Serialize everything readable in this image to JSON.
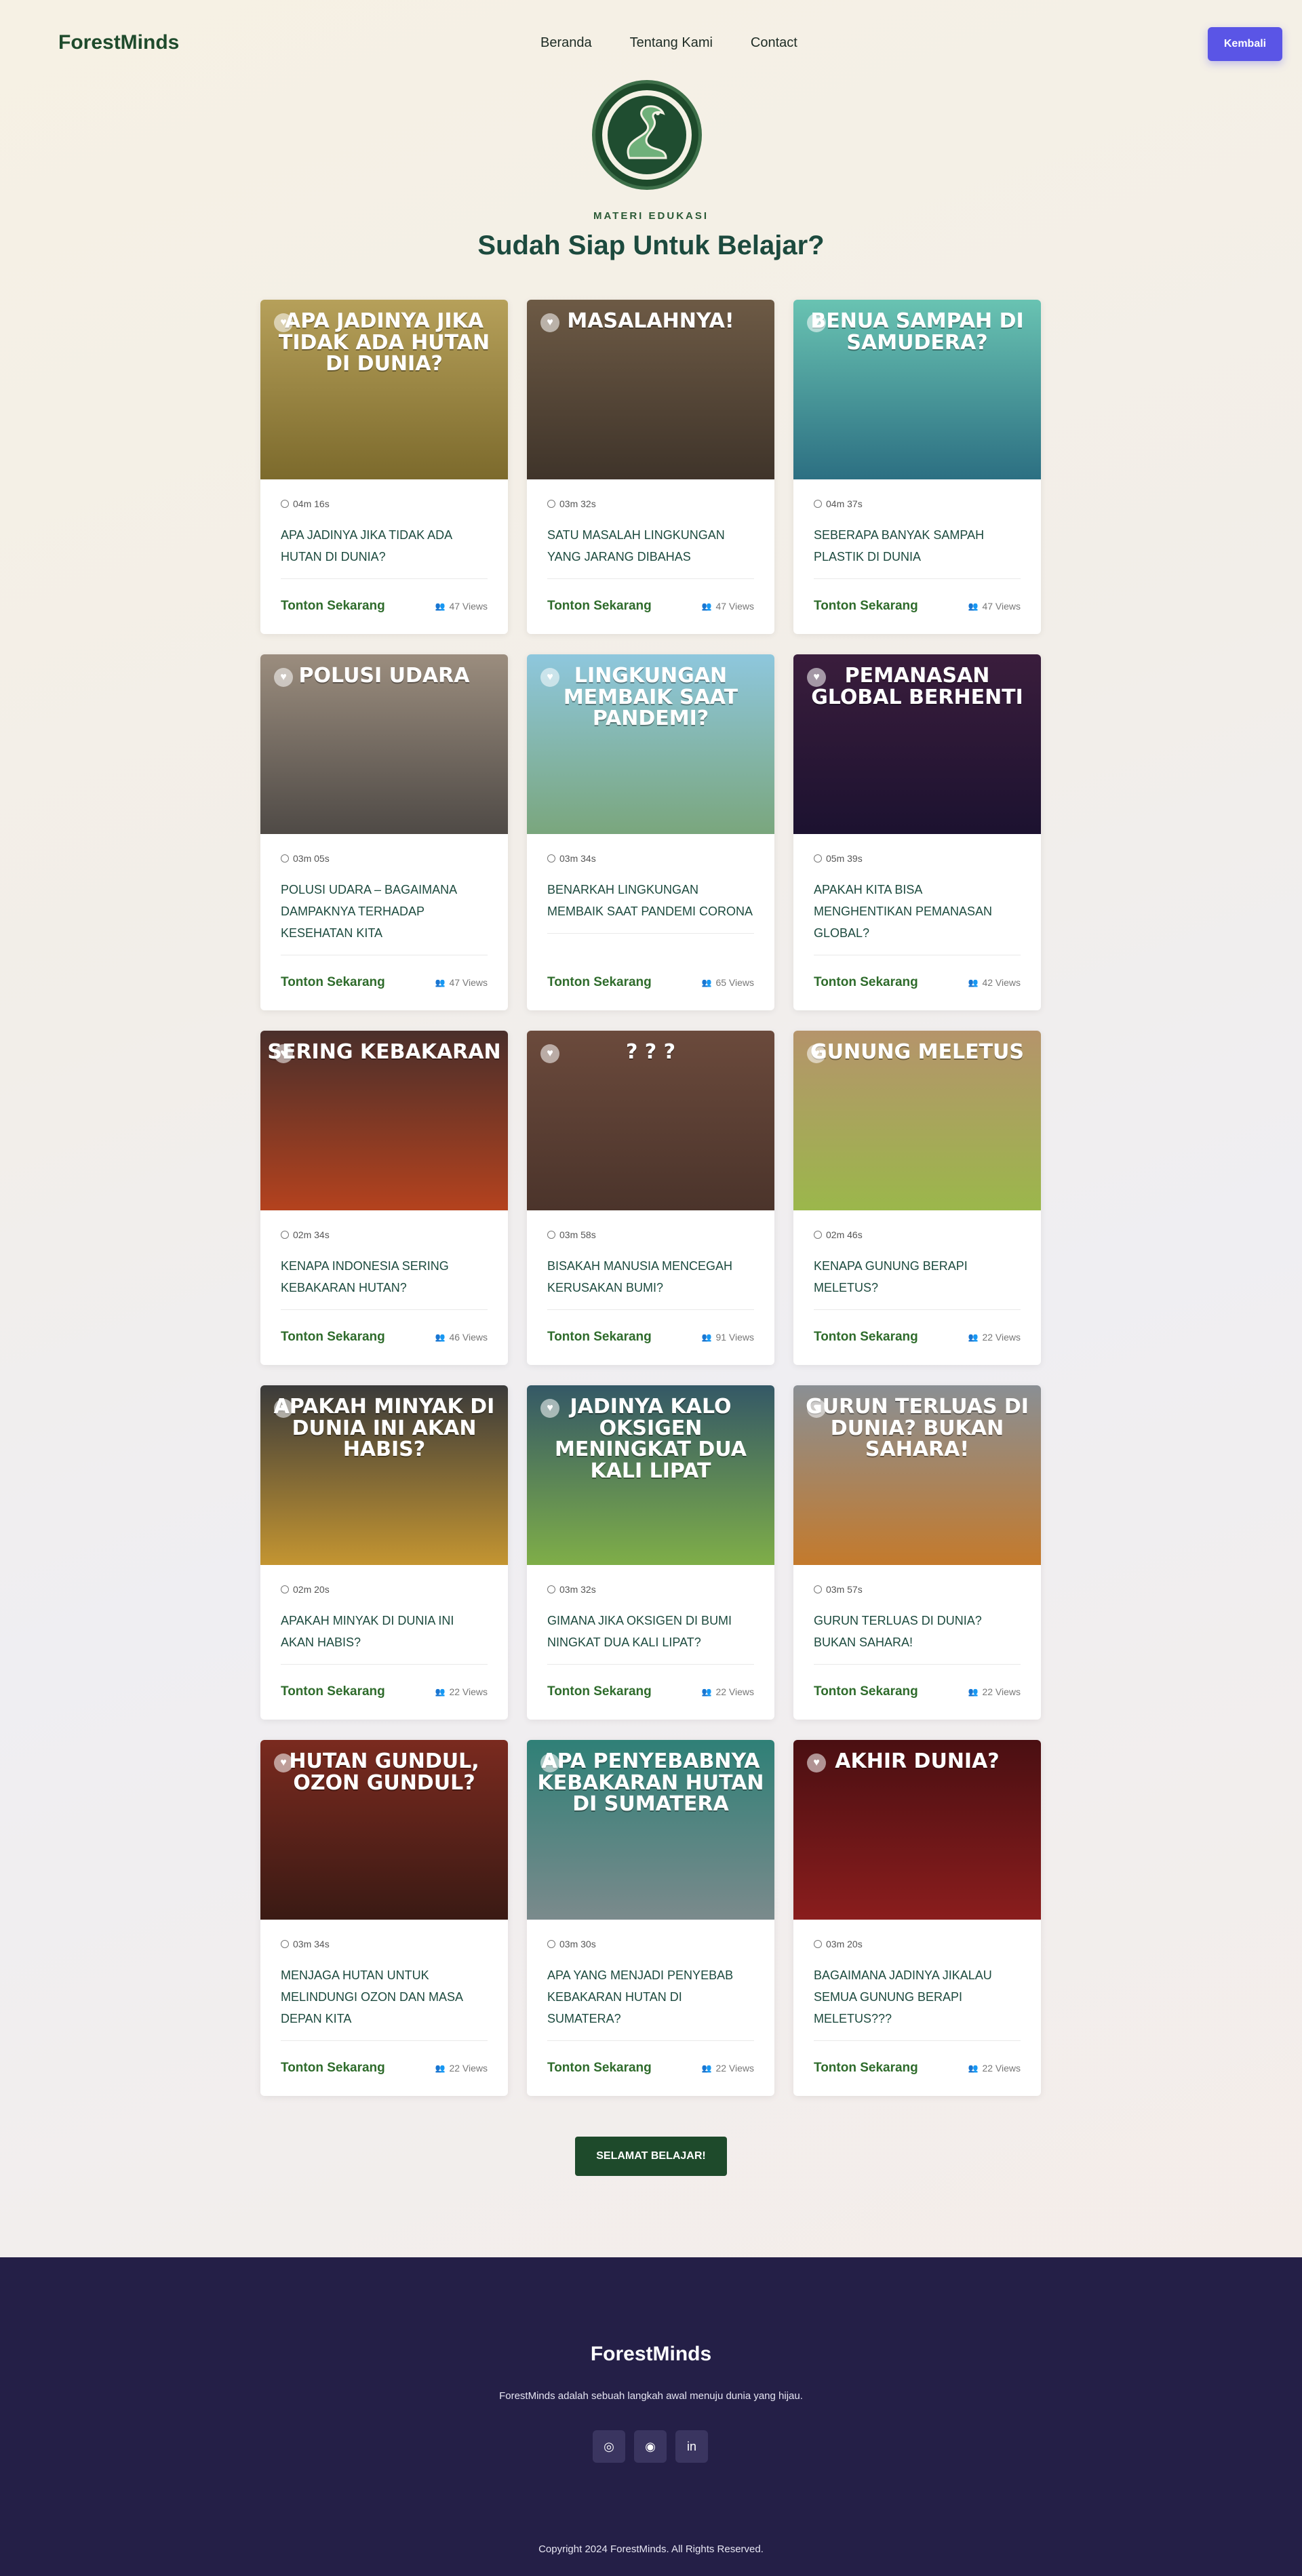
{
  "nav": {
    "brand": "ForestMinds",
    "links": [
      "Beranda",
      "Tentang Kami",
      "Contact"
    ],
    "back_label": "Kembali"
  },
  "hero": {
    "eyebrow": "MATERI EDUKASI",
    "title": "Sudah Siap Untuk Belajar?"
  },
  "cards": [
    {
      "thumb_text": "APA JADINYA JIKA TIDAK ADA HUTAN DI DUNIA?",
      "duration": "04m 16s",
      "title": "APA JADINYA JIKA TIDAK ADA HUTAN DI DUNIA?",
      "cta": "Tonton Sekarang",
      "views": "47 Views",
      "colors": [
        "#b6a05a",
        "#7c6a2c"
      ]
    },
    {
      "thumb_text": "MASALAHNYA!",
      "duration": "03m 32s",
      "title": "SATU MASALAH LINGKUNGAN YANG JARANG DIBAHAS",
      "cta": "Tonton Sekarang",
      "views": "47 Views",
      "colors": [
        "#6d5a45",
        "#3f342a"
      ]
    },
    {
      "thumb_text": "BENUA SAMPAH DI SAMUDERA?",
      "duration": "04m 37s",
      "title": "SEBERAPA BANYAK SAMPAH PLASTIK DI DUNIA",
      "cta": "Tonton Sekarang",
      "views": "47 Views",
      "colors": [
        "#69c3b2",
        "#2c6f82"
      ]
    },
    {
      "thumb_text": "POLUSI UDARA",
      "duration": "03m 05s",
      "title": "POLUSI UDARA – BAGAIMANA DAMPAKNYA TERHADAP KESEHATAN KITA",
      "cta": "Tonton Sekarang",
      "views": "47 Views",
      "colors": [
        "#9b8d7e",
        "#4f4a46"
      ]
    },
    {
      "thumb_text": "LINGKUNGAN MEMBAIK SAAT PANDEMI?",
      "duration": "03m 34s",
      "title": "BENARKAH LINGKUNGAN MEMBAIK SAAT PANDEMI CORONA",
      "cta": "Tonton Sekarang",
      "views": "65 Views",
      "colors": [
        "#8ec7dd",
        "#7aa67d"
      ]
    },
    {
      "thumb_text": "PEMANASAN GLOBAL BERHENTI",
      "duration": "05m 39s",
      "title": "APAKAH KITA BISA MENGHENTIKAN PEMANASAN GLOBAL?",
      "cta": "Tonton Sekarang",
      "views": "42 Views",
      "colors": [
        "#3a1d3c",
        "#1c1230"
      ]
    },
    {
      "thumb_text": "SERING KEBAKARAN",
      "duration": "02m 34s",
      "title": "KENAPA INDONESIA SERING KEBAKARAN HUTAN?",
      "cta": "Tonton Sekarang",
      "views": "46 Views",
      "colors": [
        "#4a2f2b",
        "#b4421e"
      ]
    },
    {
      "thumb_text": "? ? ?",
      "duration": "03m 58s",
      "title": "BISAKAH MANUSIA MENCEGAH KERUSAKAN BUMI?",
      "cta": "Tonton Sekarang",
      "views": "91 Views",
      "colors": [
        "#6b4a3c",
        "#4b342b"
      ]
    },
    {
      "thumb_text": "GUNUNG MELETUS",
      "duration": "02m 46s",
      "title": "KENAPA GUNUNG BERAPI MELETUS?",
      "cta": "Tonton Sekarang",
      "views": "22 Views",
      "colors": [
        "#b5946b",
        "#9bb74b"
      ]
    },
    {
      "thumb_text": "APAKAH MINYAK DI DUNIA INI AKAN HABIS?",
      "duration": "02m 20s",
      "title": "APAKAH MINYAK DI DUNIA INI AKAN HABIS?",
      "cta": "Tonton Sekarang",
      "views": "22 Views",
      "colors": [
        "#3a3a3a",
        "#c49531"
      ]
    },
    {
      "thumb_text": "JADINYA KALO OKSIGEN MENINGKAT DUA KALI LIPAT",
      "duration": "03m 32s",
      "title": "GIMANA JIKA OKSIGEN DI BUMI NINGKAT DUA KALI LIPAT?",
      "cta": "Tonton Sekarang",
      "views": "22 Views",
      "colors": [
        "#345866",
        "#7fae48"
      ]
    },
    {
      "thumb_text": "GURUN TERLUAS DI DUNIA? BUKAN SAHARA!",
      "duration": "03m 57s",
      "title": "GURUN TERLUAS DI DUNIA? BUKAN SAHARA!",
      "cta": "Tonton Sekarang",
      "views": "22 Views",
      "colors": [
        "#8a8f94",
        "#c47a2c"
      ]
    },
    {
      "thumb_text": "HUTAN GUNDUL, OZON GUNDUL?",
      "duration": "03m 34s",
      "title": "MENJAGA HUTAN UNTUK MELINDUNGI OZON DAN MASA DEPAN KITA",
      "cta": "Tonton Sekarang",
      "views": "22 Views",
      "colors": [
        "#7a2a1f",
        "#3a1a14"
      ]
    },
    {
      "thumb_text": "APA PENYEBABNYA KEBAKARAN HUTAN DI SUMATERA",
      "duration": "03m 30s",
      "title": "APA YANG MENJADI PENYEBAB KEBAKARAN HUTAN DI SUMATERA?",
      "cta": "Tonton Sekarang",
      "views": "22 Views",
      "colors": [
        "#2f8077",
        "#7b8a8c"
      ]
    },
    {
      "thumb_text": "AKHIR DUNIA?",
      "duration": "03m 20s",
      "title": "BAGAIMANA JADINYA JIKALAU SEMUA GUNUNG BERAPI MELETUS???",
      "cta": "Tonton Sekarang",
      "views": "22 Views",
      "colors": [
        "#4a0f12",
        "#8a1d1d"
      ]
    }
  ],
  "finish_label": "SELAMAT BELAJAR!",
  "footer": {
    "brand": "ForestMinds",
    "description": "ForestMinds adalah sebuah langkah awal menuju dunia yang hijau.",
    "socials": [
      {
        "icon": "instagram-icon",
        "glyph": "◎"
      },
      {
        "icon": "discord-icon",
        "glyph": "◉"
      },
      {
        "icon": "linkedin-icon",
        "glyph": "in"
      }
    ],
    "copyright": "Copyright 2024 ForestMinds. All Rights Reserved."
  }
}
